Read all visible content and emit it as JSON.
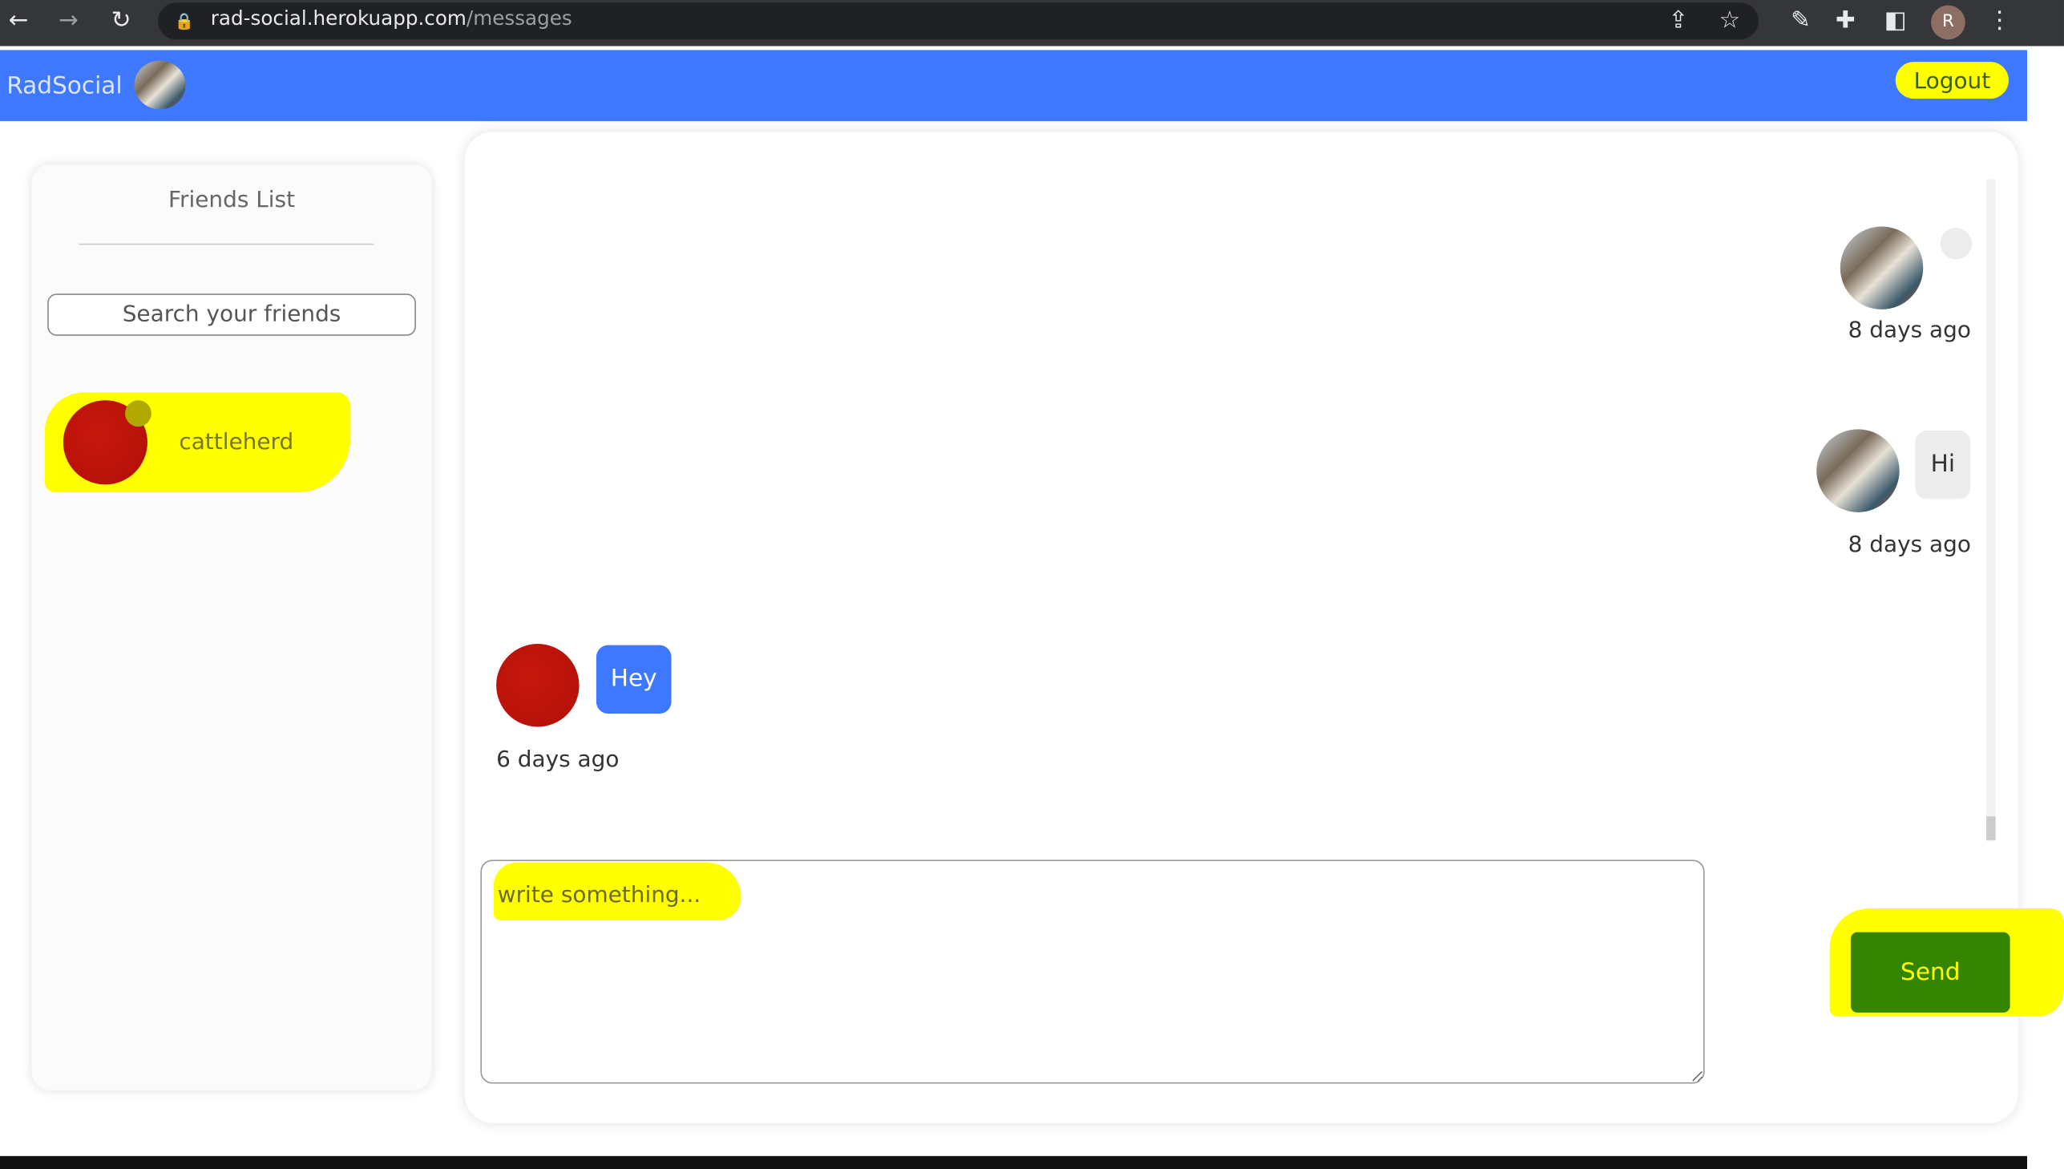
{
  "browser": {
    "url_host": "rad-social.herokuapp.com",
    "url_path": "/messages",
    "profile_initial": "R"
  },
  "navbar": {
    "brand": "RadSocial",
    "logout_label": "Logout"
  },
  "sidebar": {
    "title": "Friends List",
    "search_placeholder": "Search your friends",
    "friends": [
      {
        "name": "cattleherd",
        "online": true
      }
    ]
  },
  "chat": {
    "messages": [
      {
        "from": "me",
        "text": "",
        "time": "8 days ago"
      },
      {
        "from": "me",
        "text": "Hi",
        "time": "8 days ago"
      },
      {
        "from": "cattleherd",
        "text": "Hey",
        "time": "6 days ago"
      }
    ],
    "compose_placeholder": "write something...",
    "send_label": "Send"
  },
  "colors": {
    "navbar": "#3d78fe",
    "send_button": "#358500",
    "highlight": "#ffff00"
  }
}
